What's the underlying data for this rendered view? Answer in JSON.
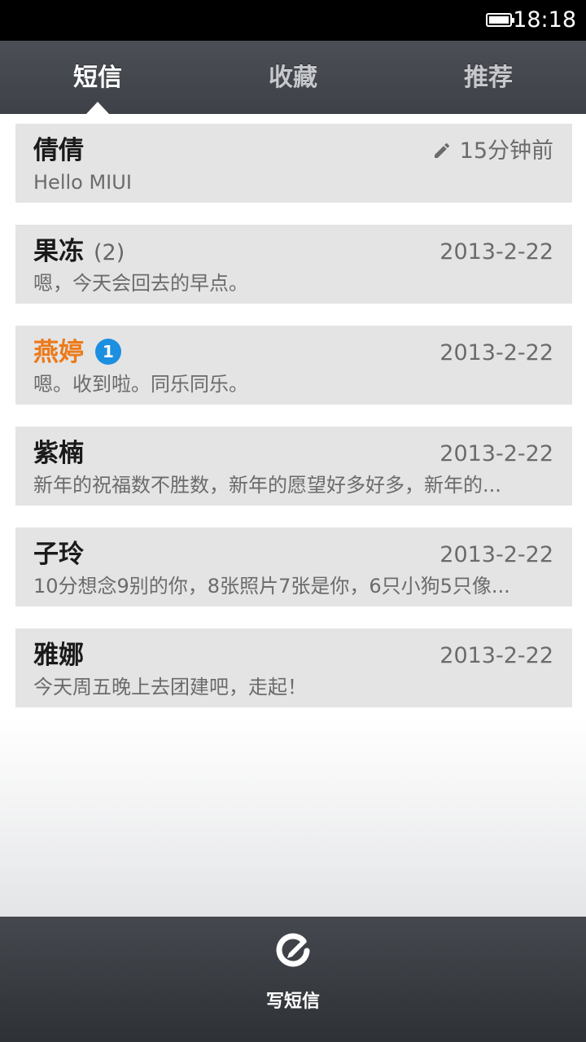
{
  "status_bar": {
    "time": "18:18"
  },
  "tabs": [
    {
      "label": "短信",
      "active": true
    },
    {
      "label": "收藏",
      "active": false
    },
    {
      "label": "推荐",
      "active": false
    }
  ],
  "messages": [
    {
      "name": "倩倩",
      "time": "15分钟前",
      "draft": true,
      "snippet": "Hello MIUI"
    },
    {
      "name": "果冻",
      "count": "(2)",
      "time": "2013-2-22",
      "snippet": "嗯，今天会回去的早点。"
    },
    {
      "name": "燕婷",
      "unread_badge": "1",
      "time": "2013-2-22",
      "snippet": "嗯。收到啦。同乐同乐。"
    },
    {
      "name": "紫楠",
      "time": "2013-2-22",
      "snippet": "新年的祝福数不胜数，新年的愿望好多好多，新年的..."
    },
    {
      "name": "子玲",
      "time": "2013-2-22",
      "snippet": "10分想念9别的你，8张照片7张是你，6只小狗5只像..."
    },
    {
      "name": "雅娜",
      "time": "2013-2-22",
      "snippet": "今天周五晚上去团建吧，走起！"
    }
  ],
  "bottom_bar": {
    "compose_label": "写短信",
    "compose_icon": "compose-icon"
  },
  "colors": {
    "unread_name": "#ec7a1a",
    "badge": "#1d8fe0",
    "tab_bar": "#44484e",
    "list_item_bg": "#e4e4e4"
  }
}
